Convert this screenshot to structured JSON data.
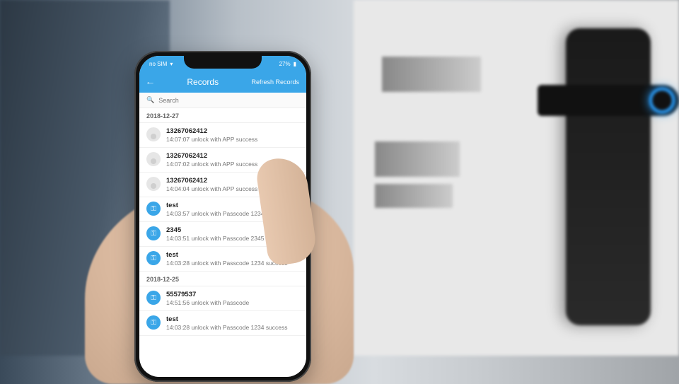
{
  "status": {
    "carrier": "no SIM",
    "battery": "27%",
    "wifi_icon": "wifi-icon",
    "battery_icon": "battery-icon"
  },
  "header": {
    "back_icon": "←",
    "title": "Records",
    "refresh_label": "Refresh Records"
  },
  "search": {
    "icon": "🔍",
    "placeholder": "Search"
  },
  "sections": [
    {
      "date": "2018-12-27",
      "rows": [
        {
          "type": "user",
          "title": "13267062412",
          "sub": "14:07:07 unlock with APP success"
        },
        {
          "type": "user",
          "title": "13267062412",
          "sub": "14:07:02 unlock with APP success"
        },
        {
          "type": "user",
          "title": "13267062412",
          "sub": "14:04:04 unlock with APP success"
        },
        {
          "type": "key",
          "title": "test",
          "sub": "14:03:57 unlock with Passcode 1234 success"
        },
        {
          "type": "key",
          "title": "2345",
          "sub": "14:03:51 unlock with Passcode 2345 failed"
        },
        {
          "type": "key",
          "title": "test",
          "sub": "14:03:28 unlock with Passcode 1234 success"
        }
      ]
    },
    {
      "date": "2018-12-25",
      "rows": [
        {
          "type": "key",
          "title": "55579537",
          "sub": "14:51:56 unlock with Passcode"
        },
        {
          "type": "key",
          "title": "test",
          "sub": "14:03:28 unlock with Passcode 1234 success"
        }
      ]
    }
  ],
  "colors": {
    "accent": "#3aa6e8",
    "ring": "#2aa0ff"
  }
}
